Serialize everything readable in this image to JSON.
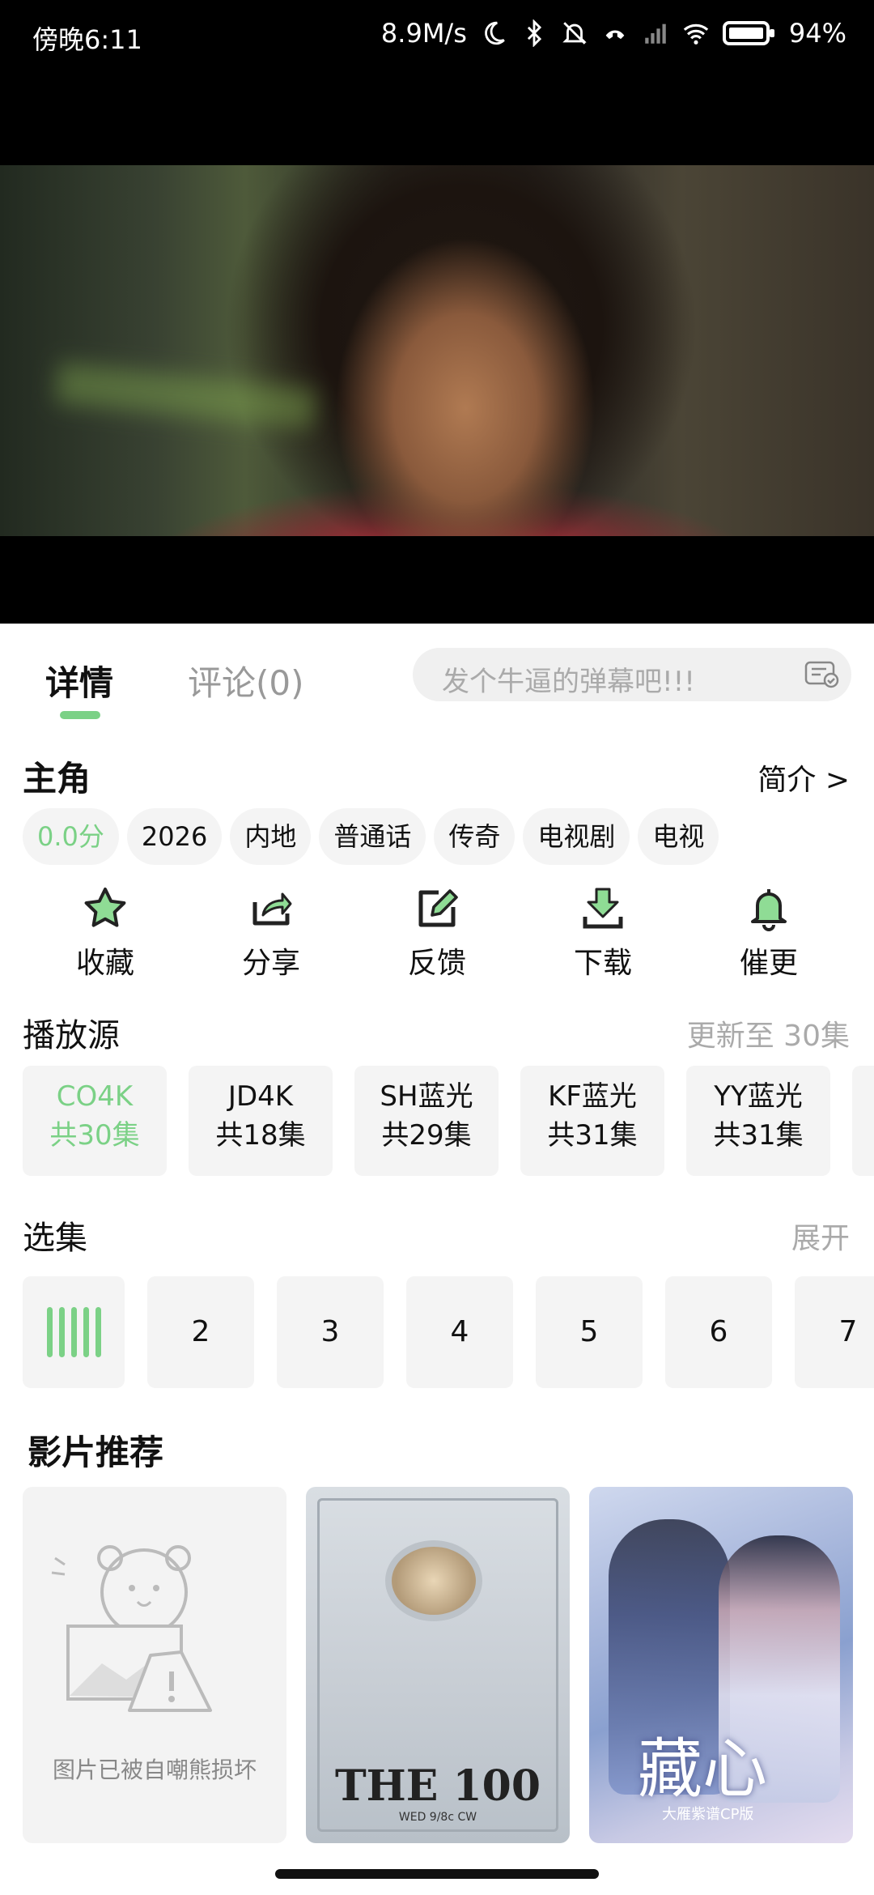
{
  "status_bar": {
    "time": "傍晚6:11",
    "speed": "8.9M/s",
    "battery": "94%",
    "icons": [
      "moon-icon",
      "bluetooth-icon",
      "mute-icon",
      "call-icon",
      "signal-icon",
      "wifi-icon",
      "battery-icon"
    ]
  },
  "tabs": {
    "detail": "详情",
    "comments": "评论(0)",
    "active": "detail",
    "accent_color": "#7bd186"
  },
  "danmaku": {
    "placeholder": "发个牛逼的弹幕吧!!!"
  },
  "info": {
    "title": "主角",
    "intro_link": "简介 >",
    "tags": [
      "0.0分",
      "2026",
      "内地",
      "普通话",
      "传奇",
      "电视剧",
      "电视"
    ]
  },
  "actions": [
    {
      "label": "收藏",
      "icon": "star-icon"
    },
    {
      "label": "分享",
      "icon": "share-icon"
    },
    {
      "label": "反馈",
      "icon": "feedback-icon"
    },
    {
      "label": "下载",
      "icon": "download-icon"
    },
    {
      "label": "催更",
      "icon": "bell-icon"
    }
  ],
  "sources": {
    "title": "播放源",
    "status": "更新至 30集",
    "items": [
      {
        "name": "CO4K",
        "count": "共30集"
      },
      {
        "name": "JD4K",
        "count": "共18集"
      },
      {
        "name": "SH蓝光",
        "count": "共29集"
      },
      {
        "name": "KF蓝光",
        "count": "共31集"
      },
      {
        "name": "YY蓝光",
        "count": "共31集"
      }
    ]
  },
  "episodes": {
    "title": "选集",
    "expand": "展开",
    "items": [
      "2",
      "3",
      "4",
      "5",
      "6",
      "7"
    ]
  },
  "recommendations": {
    "title": "影片推荐",
    "broken_text": "图片已被自嘲熊损坏",
    "poster2_logo": "THE 100",
    "poster2_sub": "WED 9/8c  CW",
    "poster3_title": "藏心",
    "poster3_sub": "大雁紫谱CP版"
  }
}
